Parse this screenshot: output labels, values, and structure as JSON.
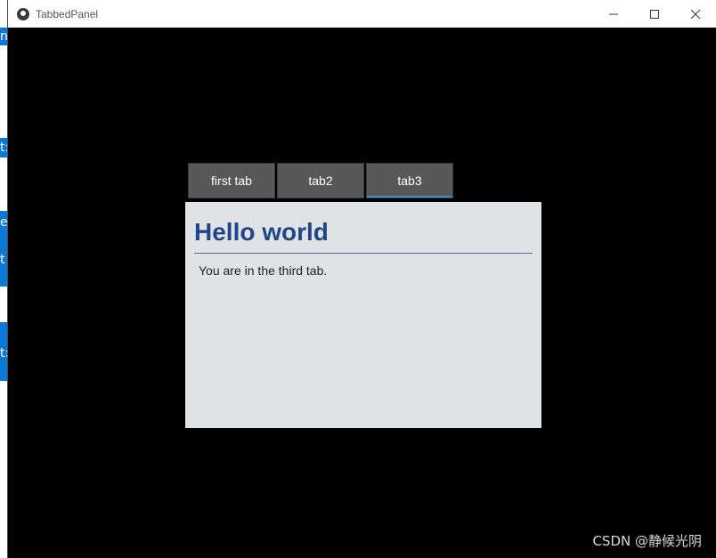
{
  "window": {
    "title": "TabbedPanel",
    "controls": {
      "minimize_icon": "minimize-icon",
      "maximize_icon": "maximize-icon",
      "close_icon": "close-icon"
    }
  },
  "background_glyphs": [
    "n",
    "t:",
    "e",
    "t",
    "t:"
  ],
  "tabs": [
    {
      "label": "first tab",
      "active": false
    },
    {
      "label": "tab2",
      "active": false
    },
    {
      "label": "tab3",
      "active": true
    }
  ],
  "content": {
    "heading": "Hello world",
    "text": "You are in the third tab."
  },
  "watermark": "CSDN @静候光阴",
  "colors": {
    "heading": "#1f4788",
    "tab_bg": "#585858",
    "panel_bg": "#e1e2e6",
    "active_indicator": "#3a8fd0",
    "client_bg": "#000000"
  }
}
